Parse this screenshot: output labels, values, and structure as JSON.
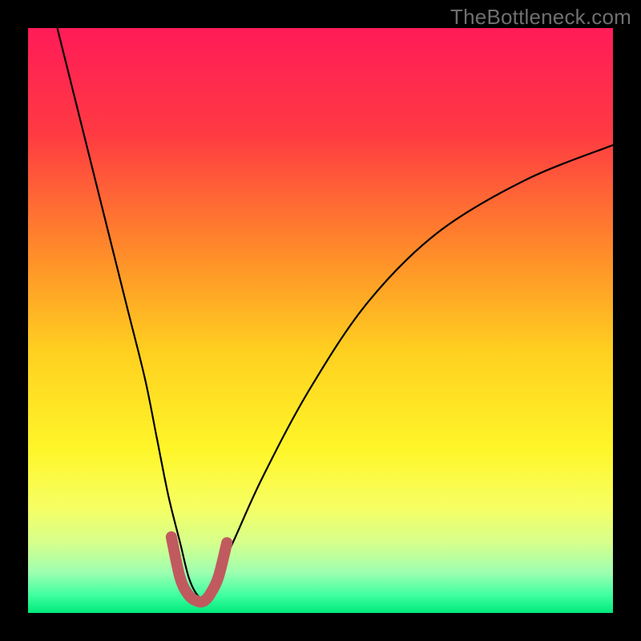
{
  "watermark": "TheBottleneck.com",
  "chart_data": {
    "type": "line",
    "title": "",
    "xlabel": "",
    "ylabel": "",
    "xlim": [
      0,
      100
    ],
    "ylim": [
      0,
      100
    ],
    "gradient_stops": [
      {
        "pos": 0.0,
        "color": "#ff1b58"
      },
      {
        "pos": 0.18,
        "color": "#ff3a43"
      },
      {
        "pos": 0.38,
        "color": "#ff8a2a"
      },
      {
        "pos": 0.55,
        "color": "#ffcf20"
      },
      {
        "pos": 0.72,
        "color": "#fff629"
      },
      {
        "pos": 0.82,
        "color": "#f6ff63"
      },
      {
        "pos": 0.88,
        "color": "#d6ff8c"
      },
      {
        "pos": 0.93,
        "color": "#9fffb0"
      },
      {
        "pos": 0.97,
        "color": "#3effa0"
      },
      {
        "pos": 1.0,
        "color": "#00e87b"
      }
    ],
    "series": [
      {
        "name": "bottleneck-curve",
        "color": "#000000",
        "x": [
          5,
          8,
          11,
          14,
          17,
          20,
          22,
          24,
          26,
          27.5,
          29,
          30,
          32,
          35,
          40,
          48,
          58,
          70,
          85,
          100
        ],
        "y": [
          100,
          88,
          76,
          64,
          52,
          40,
          30,
          20,
          12,
          6,
          3,
          3,
          6,
          12,
          23,
          38,
          53,
          65,
          74,
          80
        ]
      },
      {
        "name": "optimal-band",
        "color": "#c05a5f",
        "thick": true,
        "x": [
          24.5,
          26,
          27.5,
          29,
          30,
          31,
          32.5,
          34
        ],
        "y": [
          13,
          6,
          3,
          2,
          2,
          3,
          6,
          12
        ]
      }
    ],
    "optimal_x": 29
  }
}
